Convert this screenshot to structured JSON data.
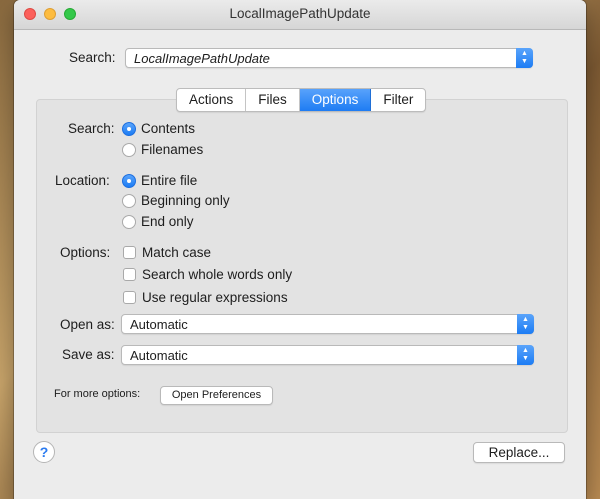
{
  "window": {
    "title": "LocalImagePathUpdate"
  },
  "search": {
    "label": "Search:",
    "value": "LocalImagePathUpdate"
  },
  "tabs": [
    {
      "label": "Actions",
      "active": false
    },
    {
      "label": "Files",
      "active": false
    },
    {
      "label": "Options",
      "active": true
    },
    {
      "label": "Filter",
      "active": false
    }
  ],
  "options": {
    "search_in": {
      "label": "Search:",
      "choices": [
        "Contents",
        "Filenames"
      ],
      "selected": "Contents"
    },
    "location": {
      "label": "Location:",
      "choices": [
        "Entire file",
        "Beginning only",
        "End only"
      ],
      "selected": "Entire file"
    },
    "checks": {
      "label": "Options:",
      "items": [
        {
          "label": "Match case",
          "checked": false
        },
        {
          "label": "Search whole words only",
          "checked": false
        },
        {
          "label": "Use regular expressions",
          "checked": false
        }
      ]
    },
    "open_as": {
      "label": "Open as:",
      "value": "Automatic"
    },
    "save_as": {
      "label": "Save as:",
      "value": "Automatic"
    },
    "more": {
      "label": "For more options:",
      "button": "Open Preferences"
    }
  },
  "footer": {
    "help": "?",
    "replace": "Replace..."
  },
  "colors": {
    "accent": "#1e7cf3",
    "window": "#ececec",
    "panel": "#e3e3e3"
  }
}
